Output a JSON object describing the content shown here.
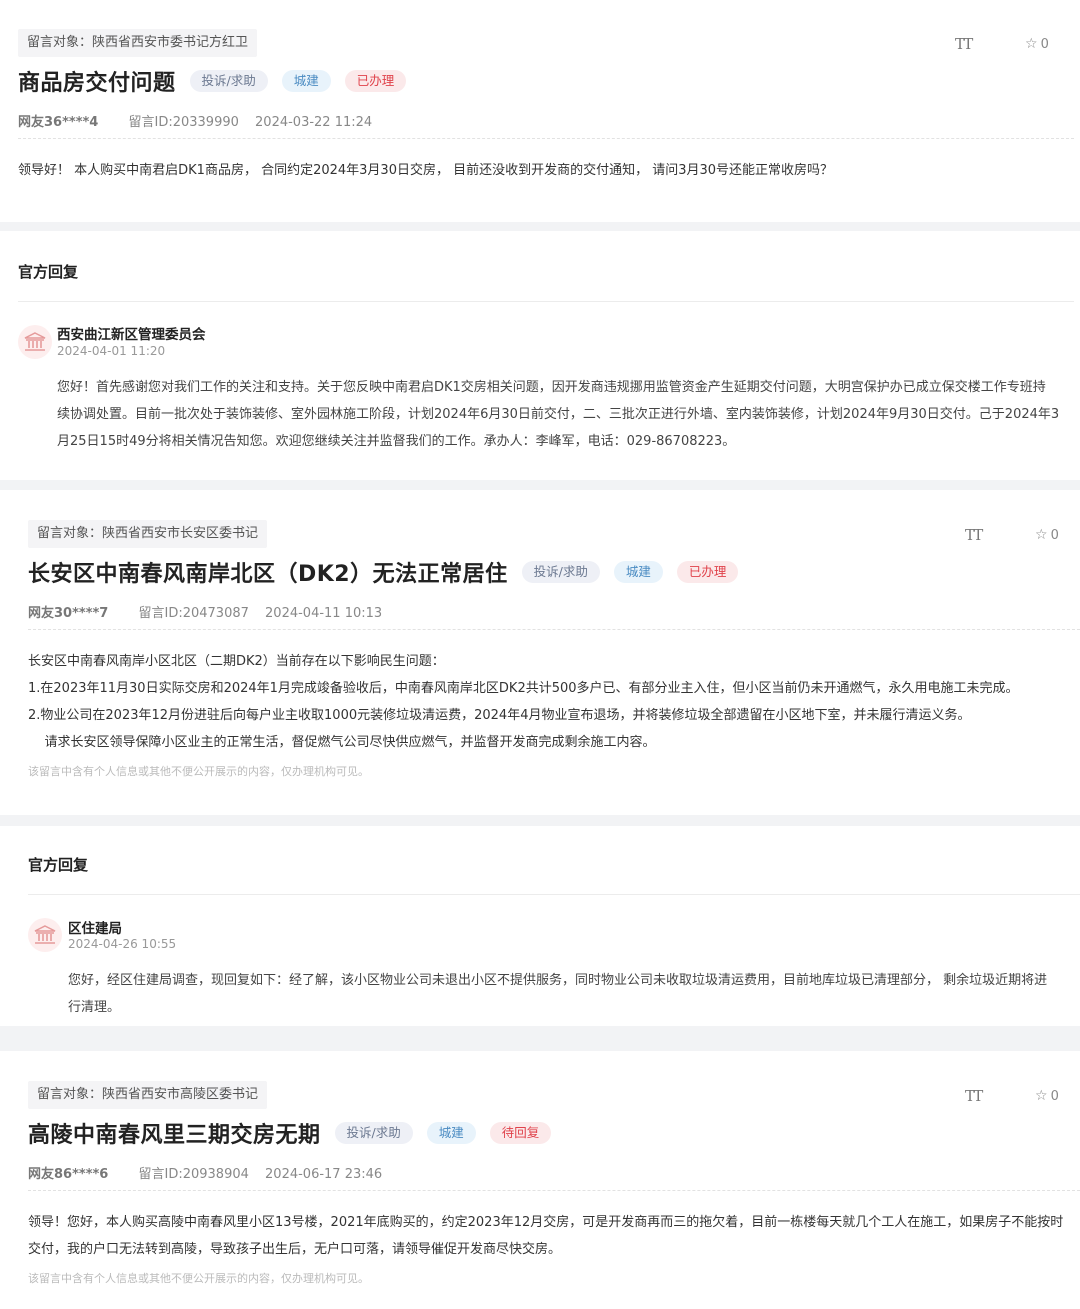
{
  "posts": [
    {
      "target": "留言对象：陕西省西安市委书记方红卫",
      "font_size_icon": "TT",
      "favorite_count": "0",
      "title": "商品房交付问题",
      "tags": {
        "category": "投诉/求助",
        "area": "城建",
        "status": "已办理"
      },
      "user": "网友36****4",
      "message_id": "留言ID:20339990",
      "time": "2024-03-22 11:24",
      "content": [
        "领导好！ 本人购买中南君启DK1商品房， 合同约定2024年3月30日交房， 目前还没收到开发商的交付通知， 请问3月30号还能正常收房吗？"
      ],
      "reply": {
        "heading": "官方回复",
        "org": "西安曲江新区管理委员会",
        "time": "2024-04-01 11:20",
        "content": [
          "您好！首先感谢您对我们工作的关注和支持。关于您反映中南君启DK1交房相关问题，因开发商违规挪用监管资金产生延期交付问题，大明宫保护办已成立保交楼工作专班持",
          "续协调处置。目前一批次处于装饰装修、室外园林施工阶段，计划2024年6月30日前交付，二、三批次正进行外墙、室内装饰装修，计划2024年9月30日交付。己于2024年3",
          "月25日15时49分将相关情况告知您。欢迎您继续关注并监督我们的工作。承办人：李峰军，电话：029-86708223。"
        ]
      }
    },
    {
      "target": "留言对象：陕西省西安市长安区委书记",
      "font_size_icon": "TT",
      "favorite_count": "0",
      "title": "长安区中南春风南岸北区（DK2）无法正常居住",
      "tags": {
        "category": "投诉/求助",
        "area": "城建",
        "status": "已办理"
      },
      "user": "网友30****7",
      "message_id": "留言ID:20473087",
      "time": "2024-04-11 10:13",
      "content": [
        "长安区中南春风南岸小区北区（二期DK2）当前存在以下影响民生问题：",
        "1.在2023年11月30日实际交房和2024年1月完成竣备验收后，中南春风南岸北区DK2共计500多户已、有部分业主入住，但小区当前仍未开通燃气，永久用电施工未完成。",
        "2.物业公司在2023年12月份进驻后向每户业主收取1000元装修垃圾清运费，2024年4月物业宣布退场，并将装修垃圾全部遗留在小区地下室，并未履行清运义务。",
        "    请求长安区领导保障小区业主的正常生活，督促燃气公司尽快供应燃气，并监督开发商完成剩余施工内容。"
      ],
      "privacy_note": "该留言中含有个人信息或其他不便公开展示的内容，仅办理机构可见。",
      "reply": {
        "heading": "官方回复",
        "org": "区住建局",
        "time": "2024-04-26 10:55",
        "content": [
          "您好，经区住建局调查，现回复如下：经了解，该小区物业公司未退出小区不提供服务，同时物业公司未收取垃圾清运费用，目前地库垃圾已清理部分， 剩余垃圾近期将进",
          "行清理。"
        ]
      }
    },
    {
      "target": "留言对象：陕西省西安市高陵区委书记",
      "font_size_icon": "TT",
      "favorite_count": "0",
      "title": "高陵中南春风里三期交房无期",
      "tags": {
        "category": "投诉/求助",
        "area": "城建",
        "status": "待回复"
      },
      "user": "网友86****6",
      "message_id": "留言ID:20938904",
      "time": "2024-06-17 23:46",
      "content": [
        "领导！您好，本人购买高陵中南春风里小区13号楼，2021年底购买的，约定2023年12月交房，可是开发商再而三的拖欠着，目前一栋楼每天就几个工人在施工，如果房子不能按时",
        "交付，我的户口无法转到高陵，导致孩子出生后，无户口可落，请领导催促开发商尽快交房。"
      ],
      "privacy_note": "该留言中含有个人信息或其他不便公开展示的内容，仅办理机构可见。"
    }
  ],
  "colors": {
    "status_red": "#e0424b",
    "area_blue": "#4a8bc2",
    "separator": "#f2f3f5"
  }
}
